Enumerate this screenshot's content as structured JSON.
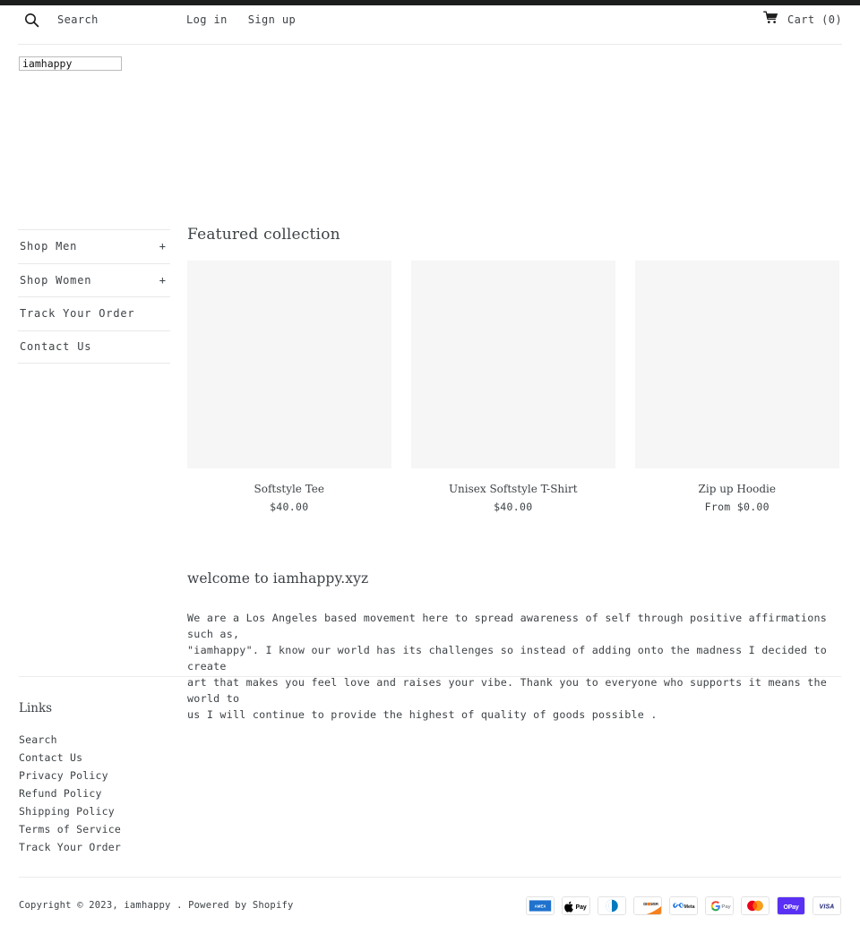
{
  "site": {
    "title_value": "iamhappy",
    "title_placeholder": "iamhappy"
  },
  "header": {
    "search_icon": "search-icon",
    "search_label": "Search",
    "login_label": "Log in",
    "signup_label": "Sign up",
    "cart_icon": "shopping-cart-icon",
    "cart_label": "Cart (0)",
    "cart_count": 0
  },
  "sidebar": {
    "items": [
      {
        "label": "Shop Men",
        "expander": "+",
        "has_expander": true
      },
      {
        "label": "Shop Women",
        "expander": "+",
        "has_expander": true
      },
      {
        "label": "Track Your Order",
        "expander": "",
        "has_expander": false
      },
      {
        "label": "Contact Us",
        "expander": "",
        "has_expander": false
      }
    ]
  },
  "featured": {
    "heading": "Featured collection",
    "products": [
      {
        "title": "Softstyle Tee",
        "price": "$40.00"
      },
      {
        "title": "Unisex Softstyle T-Shirt",
        "price": "$40.00"
      },
      {
        "title": "Zip up Hoodie",
        "price": "From $0.00"
      }
    ]
  },
  "welcome": {
    "heading": "welcome to iamhappy.xyz",
    "body": "We are a Los Angeles based movement here to spread awareness of self through positive affirmations such as,\n\"iamhappy\". I know our world has its challenges so instead of adding onto the madness I decided to create\nart that makes you feel love and raises your vibe. Thank you to everyone who supports it means the world to\nus I will continue to provide the highest of quality of goods possible ."
  },
  "footer": {
    "heading": "Links",
    "links": [
      "Search",
      "Contact Us",
      "Privacy Policy",
      "Refund Policy",
      "Shipping Policy",
      "Terms of Service",
      "Track Your Order"
    ],
    "copyright": "Copyright © 2023, iamhappy . Powered by Shopify",
    "payment_methods": [
      "american-express",
      "apple-pay",
      "diners-club",
      "discover",
      "meta-pay",
      "google-pay",
      "mastercard",
      "shop-pay",
      "visa"
    ]
  },
  "colors": {
    "text": "#3d4246",
    "topbar": "#1c1d1d",
    "rule": "#e8e9eb",
    "placeholder": "#f6f6f7"
  }
}
